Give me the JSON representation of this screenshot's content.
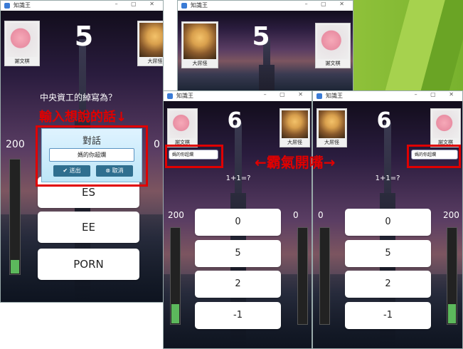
{
  "app_title": "知識王",
  "window_controls": "– ▢ ✕",
  "win1": {
    "player_left": "謝文棋",
    "player_right": "大屌怪",
    "timer": "5",
    "question": "中央資工的綽寫為？",
    "score_left": "200",
    "score_right": "0",
    "left_bar_level": 0.12,
    "options": [
      "ES",
      "EE",
      "PORN"
    ],
    "dialog": {
      "title": "對話",
      "input_value": "媽的你超爛",
      "send_label": "✔ 送出",
      "cancel_label": "⊗ 取消"
    }
  },
  "win2": {
    "player_left": "大屌怪",
    "player_right": "謝文棋",
    "timer": "5"
  },
  "win3": {
    "player_left": "謝文棋",
    "player_right": "大屌怪",
    "timer": "6",
    "chat_value": "媽的你超爛",
    "question": "1+1=?",
    "score_left": "200",
    "score_right": "0",
    "left_bar_level": 0.2,
    "options": [
      "0",
      "5",
      "2",
      "-1"
    ]
  },
  "win4": {
    "player_left": "大屌怪",
    "player_right": "謝文棋",
    "timer": "6",
    "chat_value": "媽的你超爛",
    "question": "1+1=?",
    "score_left": "0",
    "score_right": "200",
    "right_bar_level": 0.2,
    "options": [
      "0",
      "5",
      "2",
      "-1"
    ]
  },
  "annotations": {
    "input_hint": "輸入想說的話↓",
    "bully_talk": "←霸氣開嘴→"
  },
  "colors": {
    "annotation_red": "#e00000",
    "bar_green": "#5cb85c"
  }
}
